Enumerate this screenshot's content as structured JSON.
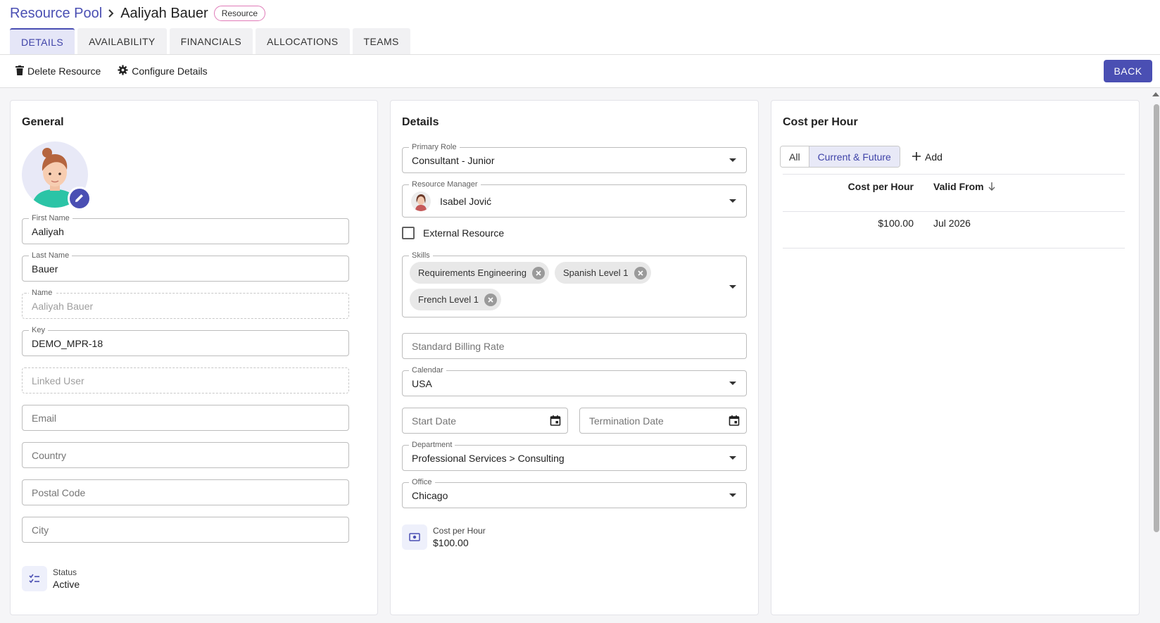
{
  "header": {
    "breadcrumb_root": "Resource Pool",
    "breadcrumb_current": "Aaliyah Bauer",
    "type_badge": "Resource"
  },
  "tabs": [
    {
      "label": "DETAILS",
      "active": true
    },
    {
      "label": "AVAILABILITY",
      "active": false
    },
    {
      "label": "FINANCIALS",
      "active": false
    },
    {
      "label": "ALLOCATIONS",
      "active": false
    },
    {
      "label": "TEAMS",
      "active": false
    }
  ],
  "actions": {
    "delete_label": "Delete Resource",
    "configure_label": "Configure Details",
    "back_label": "BACK"
  },
  "general": {
    "title": "General",
    "first_name": {
      "label": "First Name",
      "value": "Aaliyah"
    },
    "last_name": {
      "label": "Last Name",
      "value": "Bauer"
    },
    "name": {
      "label": "Name",
      "value": "Aaliyah Bauer"
    },
    "key": {
      "label": "Key",
      "value": "DEMO_MPR-18"
    },
    "linked_user": {
      "placeholder": "Linked User"
    },
    "email": {
      "placeholder": "Email"
    },
    "country": {
      "placeholder": "Country"
    },
    "postal_code": {
      "placeholder": "Postal Code"
    },
    "city": {
      "placeholder": "City"
    },
    "status": {
      "label": "Status",
      "value": "Active"
    }
  },
  "details": {
    "title": "Details",
    "primary_role": {
      "label": "Primary Role",
      "value": "Consultant - Junior"
    },
    "resource_manager": {
      "label": "Resource Manager",
      "value": "Isabel Jović"
    },
    "external_resource": {
      "label": "External Resource",
      "checked": false
    },
    "skills": {
      "label": "Skills",
      "chips": [
        "Requirements Engineering",
        "Spanish Level 1",
        "French Level 1"
      ]
    },
    "standard_billing_rate": {
      "placeholder": "Standard Billing Rate"
    },
    "calendar": {
      "label": "Calendar",
      "value": "USA"
    },
    "start_date": {
      "placeholder": "Start Date"
    },
    "termination_date": {
      "placeholder": "Termination Date"
    },
    "department": {
      "label": "Department",
      "value": "Professional Services > Consulting"
    },
    "office": {
      "label": "Office",
      "value": "Chicago"
    },
    "cost_per_hour": {
      "label": "Cost per Hour",
      "value": "$100.00"
    }
  },
  "cost": {
    "title": "Cost per Hour",
    "filters": [
      {
        "label": "All",
        "active": false
      },
      {
        "label": "Current & Future",
        "active": true
      }
    ],
    "add_label": "Add",
    "columns": [
      "Cost per Hour",
      "Valid From"
    ],
    "rows": [
      {
        "cost": "$100.00",
        "valid_from": "Jul 2026"
      }
    ]
  },
  "colors": {
    "accent": "#4a4fb3",
    "badge_border": "#e07bb8"
  }
}
